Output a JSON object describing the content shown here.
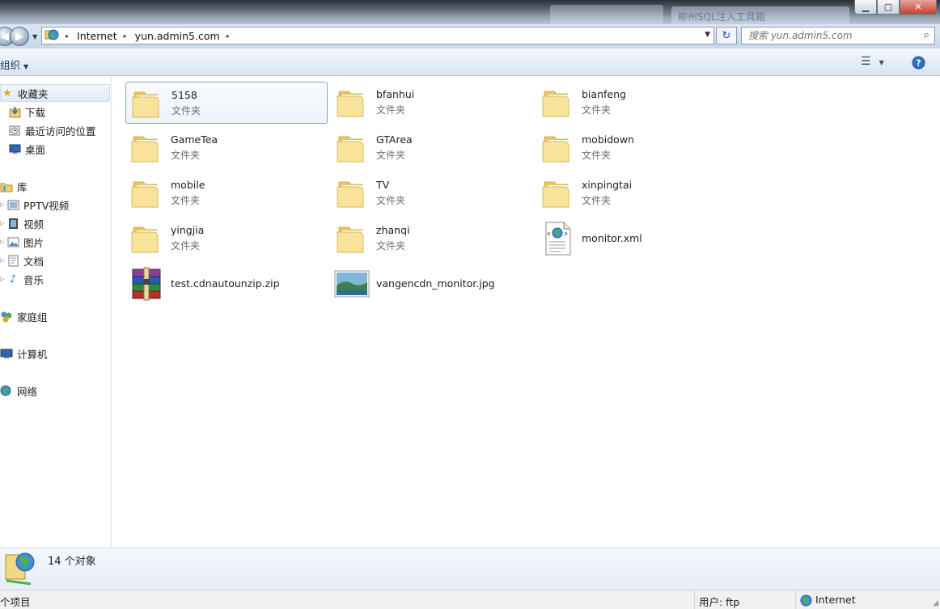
{
  "window": {
    "background_items": [
      "",
      "柳州SQL注入工具箱"
    ],
    "minimize_glyph": "▁",
    "maximize_glyph": "▢",
    "close_glyph": "✕"
  },
  "address": {
    "back_glyph": "◀",
    "forward_glyph": "▶",
    "dropdown_glyph": "▼",
    "crumbs": [
      "Internet",
      "yun.admin5.com"
    ],
    "crumb_sep": "▸",
    "refresh_glyph": "↻",
    "search_placeholder": "搜索 yun.admin5.com",
    "search_glyph": "⌕"
  },
  "toolbar": {
    "organize_label": "组织",
    "arrow_glyph": "▼",
    "view_glyph": "☰",
    "help_glyph": "?"
  },
  "nav": {
    "favorites": {
      "label": "收藏夹",
      "icon": "star-icon"
    },
    "favorite_items": [
      {
        "label": "下载",
        "icon": "download-icon"
      },
      {
        "label": "最近访问的位置",
        "icon": "recent-places-icon"
      },
      {
        "label": "桌面",
        "icon": "desktop-icon"
      }
    ],
    "libraries": {
      "label": "库",
      "icon": "library-icon"
    },
    "library_items": [
      {
        "label": "PPTV视频",
        "icon": "video-library-icon"
      },
      {
        "label": "视频",
        "icon": "video-icon"
      },
      {
        "label": "图片",
        "icon": "pictures-icon"
      },
      {
        "label": "文档",
        "icon": "documents-icon"
      },
      {
        "label": "音乐",
        "icon": "music-icon"
      }
    ],
    "homegroup": {
      "label": "家庭组",
      "icon": "homegroup-icon"
    },
    "computer": {
      "label": "计算机",
      "icon": "computer-icon"
    },
    "network": {
      "label": "网络",
      "icon": "network-icon"
    },
    "expander_glyph": "▷"
  },
  "files": [
    {
      "name": "5158",
      "type": "文件夹",
      "kind": "folder"
    },
    {
      "name": "bfanhui",
      "type": "文件夹",
      "kind": "folder"
    },
    {
      "name": "bianfeng",
      "type": "文件夹",
      "kind": "folder"
    },
    {
      "name": "GameTea",
      "type": "文件夹",
      "kind": "folder"
    },
    {
      "name": "GTArea",
      "type": "文件夹",
      "kind": "folder"
    },
    {
      "name": "mobidown",
      "type": "文件夹",
      "kind": "folder"
    },
    {
      "name": "mobile",
      "type": "文件夹",
      "kind": "folder"
    },
    {
      "name": "TV",
      "type": "文件夹",
      "kind": "folder"
    },
    {
      "name": "xinpingtai",
      "type": "文件夹",
      "kind": "folder"
    },
    {
      "name": "yingjia",
      "type": "文件夹",
      "kind": "folder"
    },
    {
      "name": "zhanqi",
      "type": "文件夹",
      "kind": "folder"
    },
    {
      "name": "monitor.xml",
      "type": "",
      "kind": "xml"
    },
    {
      "name": "test.cdnautounzip.zip",
      "type": "",
      "kind": "zip"
    },
    {
      "name": "vangencdn_monitor.jpg",
      "type": "",
      "kind": "jpg"
    }
  ],
  "details": {
    "count_text": "14 个对象"
  },
  "status": {
    "items_text": "个项目",
    "user_text": "用户: ftp",
    "zone_text": "Internet",
    "resize_glyph": "◢"
  },
  "colors": {
    "folder_back": "#e8c462",
    "folder_front": "#f7e39a",
    "accent": "#7da2ce"
  }
}
